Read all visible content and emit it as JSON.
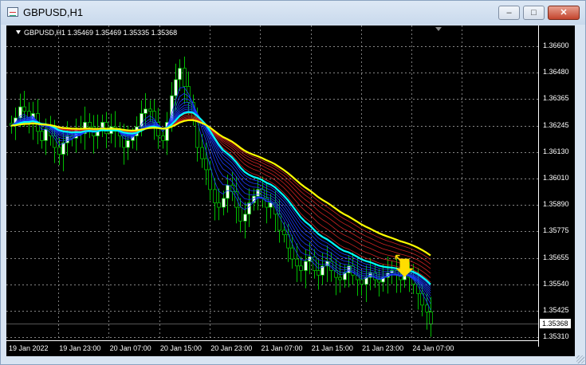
{
  "window": {
    "title": "GBPUSD,H1",
    "minimize_glyph": "–",
    "maximize_glyph": "□",
    "close_glyph": "✕"
  },
  "chart_info": "GBPUSD,H1 1.35469 1.35469 1.35335 1.35368",
  "current_price_label": "1.35368",
  "colors": {
    "background": "#000000",
    "grid": "#b0b0b0",
    "bull_candle": "#ffffff",
    "bear_candle": "#000000",
    "wick": "#00c000",
    "ma_slow": "#ffff00",
    "ma_fast": "#00ffff",
    "ribbon_red": "#cc2222",
    "ribbon_blue": "#1a3aff",
    "signal_arrow": "#ffdd00"
  },
  "chart_data": {
    "type": "candlestick",
    "symbol": "GBPUSD",
    "timeframe": "H1",
    "y_ticks": [
      "1.36600",
      "1.36480",
      "1.36365",
      "1.36245",
      "1.36130",
      "1.36010",
      "1.35890",
      "1.35775",
      "1.35655",
      "1.35540",
      "1.35425",
      "1.35310"
    ],
    "x_ticks": [
      "19 Jan 2022",
      "19 Jan 23:00",
      "20 Jan 07:00",
      "20 Jan 15:00",
      "20 Jan 23:00",
      "21 Jan 07:00",
      "21 Jan 15:00",
      "21 Jan 23:00",
      "24 Jan 07:00"
    ],
    "ylim": [
      1.3528,
      1.3675
    ],
    "close_series": [
      1.36245,
      1.3628,
      1.3633,
      1.3631,
      1.3626,
      1.363,
      1.3622,
      1.3618,
      1.3623,
      1.362,
      1.3615,
      1.3612,
      1.3617,
      1.362,
      1.3619,
      1.3623,
      1.3621,
      1.3626,
      1.3624,
      1.362,
      1.3623,
      1.3626,
      1.3621,
      1.3624,
      1.3622,
      1.362,
      1.3615,
      1.3618,
      1.362,
      1.3624,
      1.363,
      1.3632,
      1.3631,
      1.3626,
      1.362,
      1.3618,
      1.3626,
      1.3638,
      1.3645,
      1.365,
      1.3642,
      1.3635,
      1.3628,
      1.3615,
      1.361,
      1.3605,
      1.3596,
      1.359,
      1.3588,
      1.3592,
      1.3598,
      1.3595,
      1.3588,
      1.3582,
      1.3585,
      1.359,
      1.3593,
      1.3596,
      1.3592,
      1.3588,
      1.359,
      1.3585,
      1.3578,
      1.3576,
      1.357,
      1.3565,
      1.3562,
      1.356,
      1.3564,
      1.3566,
      1.356,
      1.3558,
      1.3562,
      1.3564,
      1.356,
      1.3557,
      1.3556,
      1.3559,
      1.3562,
      1.3558,
      1.3556,
      1.3554,
      1.3557,
      1.3559,
      1.3556,
      1.3555,
      1.3557,
      1.3559,
      1.356,
      1.3558,
      1.3556,
      1.3559,
      1.3557,
      1.3554,
      1.355,
      1.3545,
      1.3542,
      1.35368
    ],
    "signal": {
      "type": "down-arrow",
      "price": 1.3561
    }
  }
}
